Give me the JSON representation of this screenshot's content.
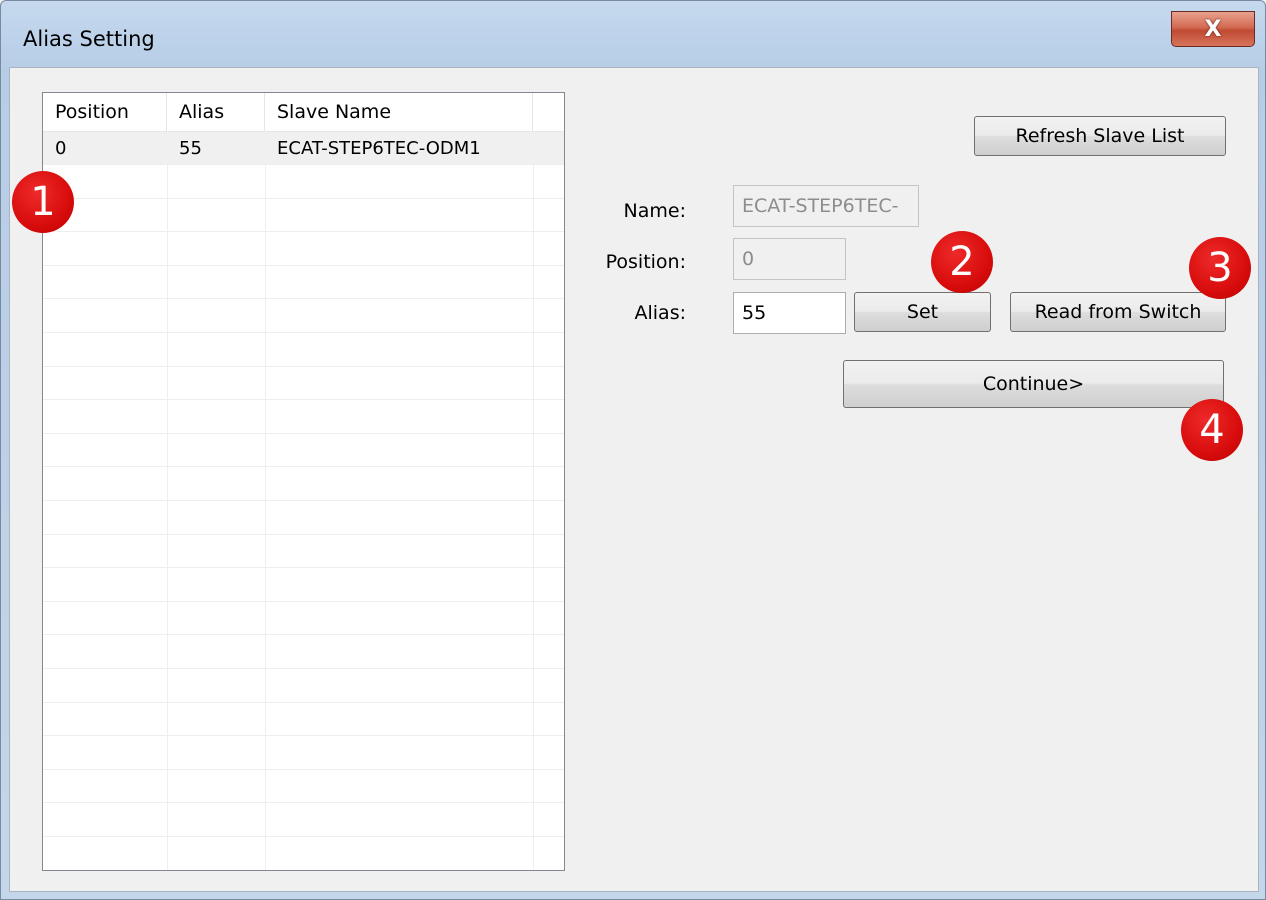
{
  "window": {
    "title": "Alias Setting",
    "close_label": "X"
  },
  "slave_list": {
    "columns": [
      "Position",
      "Alias",
      "Slave Name"
    ],
    "rows": [
      {
        "position": "0",
        "alias": "55",
        "slave_name": "ECAT-STEP6TEC-ODM1"
      }
    ]
  },
  "form": {
    "name_label": "Name:",
    "name_value": "ECAT-STEP6TEC-",
    "position_label": "Position:",
    "position_value": "0",
    "alias_label": "Alias:",
    "alias_value": "55"
  },
  "buttons": {
    "refresh": "Refresh Slave List",
    "set": "Set",
    "read_from_switch": "Read from Switch",
    "continue": "Continue>"
  },
  "badges": [
    "1",
    "2",
    "3",
    "4"
  ],
  "colors": {
    "badge": "#d80c0c",
    "title_bar": "#bcd2ea",
    "close_button": "#c14a32"
  }
}
